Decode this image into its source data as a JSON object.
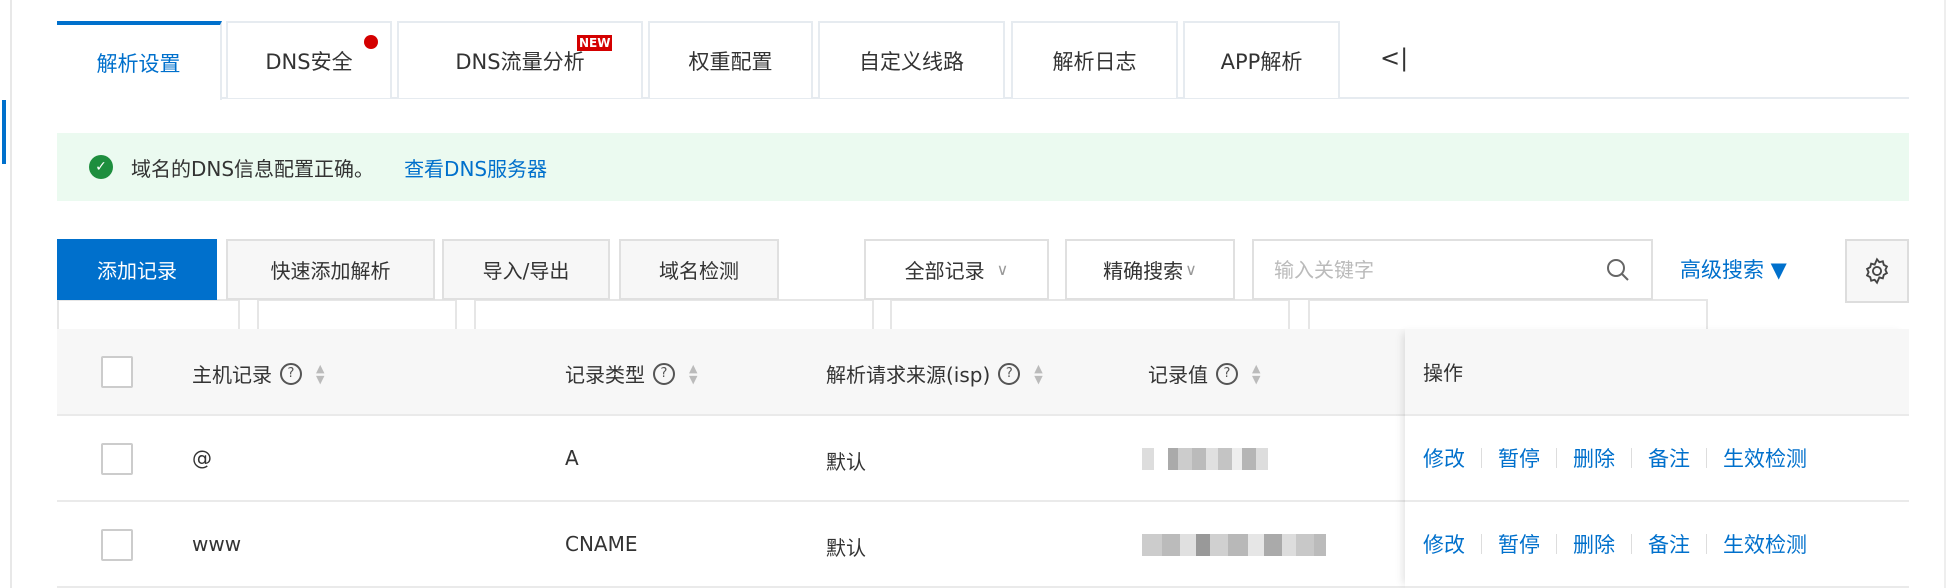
{
  "tabs": [
    {
      "label": "解析设置",
      "active": true
    },
    {
      "label": "DNS安全",
      "dot": true
    },
    {
      "label": "DNS流量分析",
      "badge": "NEW"
    },
    {
      "label": "权重配置"
    },
    {
      "label": "自定义线路"
    },
    {
      "label": "解析日志"
    },
    {
      "label": "APP解析"
    }
  ],
  "collapse_label": "<|",
  "alert": {
    "text": "域名的DNS信息配置正确。",
    "link": "查看DNS服务器",
    "icon": "check-circle-icon",
    "color": "#1e8e3e"
  },
  "toolbar": {
    "add": "添加记录",
    "quick_add": "快速添加解析",
    "import_export": "导入/导出",
    "check": "域名检测",
    "filter_select": "全部记录",
    "match_select": "精确搜索",
    "search_placeholder": "输入关键字",
    "advanced": "高级搜索 ▼"
  },
  "table": {
    "headers": [
      "主机记录",
      "记录类型",
      "解析请求来源(isp)",
      "记录值",
      "操作"
    ],
    "rows": [
      {
        "host": "@",
        "type": "A",
        "isp": "默认"
      },
      {
        "host": "www",
        "type": "CNAME",
        "isp": "默认"
      }
    ],
    "actions": [
      "修改",
      "暂停",
      "删除",
      "备注",
      "生效检测"
    ]
  },
  "colors": {
    "accent": "#0070cc",
    "alert_bg": "#ebfaf0",
    "dot": "#d40000"
  }
}
